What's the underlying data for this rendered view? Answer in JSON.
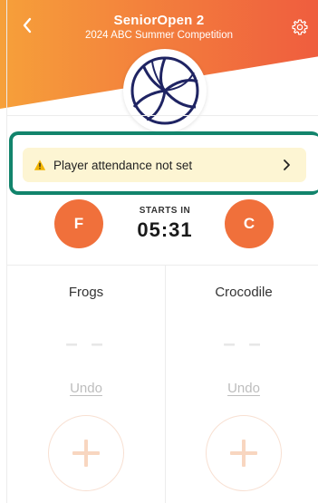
{
  "header": {
    "title": "SeniorOpen 2",
    "subtitle": "2024 ABC Summer Competition",
    "back_icon": "chevron-left-icon",
    "settings_icon": "gear-icon",
    "sport_icon": "volleyball-icon"
  },
  "attendance_banner": {
    "text": "Player attendance not set",
    "warning_icon": "warning-icon",
    "chevron_icon": "chevron-right-icon"
  },
  "match": {
    "starts_in_label": "STARTS IN",
    "countdown": "05:31"
  },
  "teams": [
    {
      "initial": "F",
      "name": "Frogs",
      "score": "– –",
      "undo_label": "Undo"
    },
    {
      "initial": "C",
      "name": "Crocodile",
      "score": "– –",
      "undo_label": "Undo"
    }
  ],
  "colors": {
    "accent": "#f0703b",
    "header_gradient_start": "#f6a03a",
    "header_gradient_end": "#ef5d3e",
    "highlight": "#12846c",
    "banner_bg": "#fdf5d3",
    "warning": "#f2b400"
  }
}
